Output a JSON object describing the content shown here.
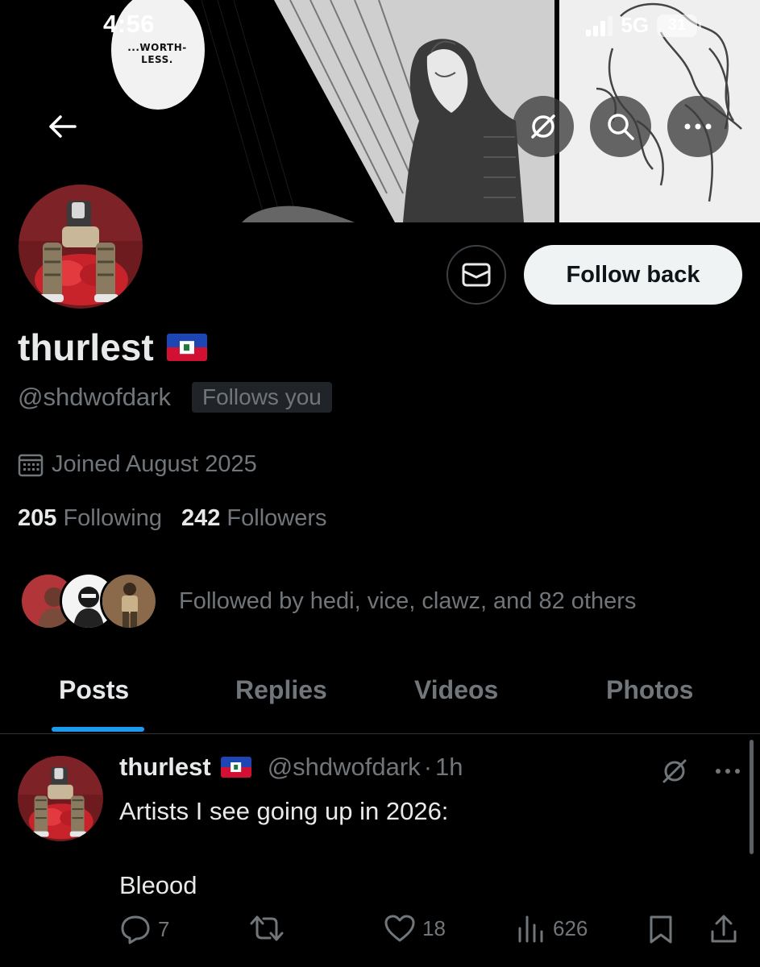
{
  "status_bar": {
    "time": "4:56",
    "network": "5G",
    "battery": "31"
  },
  "banner": {
    "speech_bubble_text": "...WORTH-\nLESS."
  },
  "profile": {
    "display_name": "thurlest",
    "flag": "haiti-flag",
    "handle": "@shdwofdark",
    "follows_you_badge": "Follows you",
    "joined": "Joined August 2025",
    "following_count": "205",
    "following_label": "Following",
    "followers_count": "242",
    "followers_label": "Followers",
    "followed_by": "Followed by hedi, vice, clawz, and 82 others",
    "follow_button": "Follow back"
  },
  "tabs": [
    {
      "label": "Posts",
      "active": true
    },
    {
      "label": "Replies",
      "active": false
    },
    {
      "label": "Videos",
      "active": false
    },
    {
      "label": "Photos",
      "active": false
    }
  ],
  "post": {
    "name": "thurlest",
    "handle": "@shdwofdark",
    "separator": "·",
    "time": "1h",
    "text_line1": "Artists I see going up in 2026:",
    "text_line2": "Bleood",
    "replies": "7",
    "reposts": "",
    "likes": "18",
    "views": "626"
  },
  "colors": {
    "background": "#000000",
    "text_primary": "#e7e9ea",
    "text_secondary": "#71767b",
    "accent": "#1d9bf0",
    "follow_button_bg": "#eff3f4",
    "border": "#2f3336"
  },
  "icons": {
    "back": "arrow-left-icon",
    "grok": "grok-icon",
    "search": "search-icon",
    "more": "more-icon",
    "dm": "envelope-icon",
    "calendar": "calendar-icon",
    "reply": "reply-icon",
    "repost": "repost-icon",
    "like": "heart-icon",
    "views": "views-icon",
    "bookmark": "bookmark-icon",
    "share": "share-icon"
  }
}
